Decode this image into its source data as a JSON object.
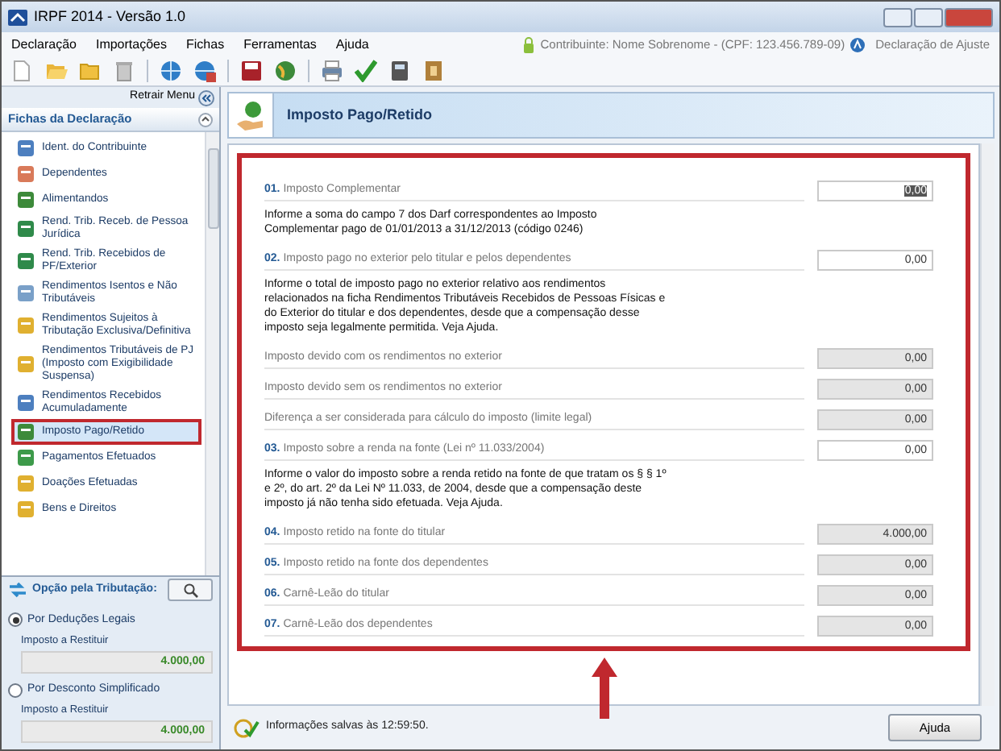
{
  "window": {
    "title": "IRPF 2014 - Versão 1.0"
  },
  "menu": [
    "Declaração",
    "Importações",
    "Fichas",
    "Ferramentas",
    "Ajuda"
  ],
  "header_info": {
    "taxpayer": "Contribuinte: Nome Sobrenome - (CPF: 123.456.789-09)",
    "declaration": "Declaração de Ajuste"
  },
  "sidebar": {
    "collapse_label": "Retrair Menu",
    "section_title": "Fichas da Declaração",
    "items": [
      {
        "label": "Ident. do Contribuinte",
        "selected": false,
        "highlighted": false
      },
      {
        "label": "Dependentes",
        "selected": false,
        "highlighted": false
      },
      {
        "label": "Alimentandos",
        "selected": false,
        "highlighted": false
      },
      {
        "label": "Rend. Trib. Receb. de Pessoa Jurídica",
        "selected": false,
        "highlighted": false
      },
      {
        "label": "Rend. Trib. Recebidos de PF/Exterior",
        "selected": false,
        "highlighted": false
      },
      {
        "label": "Rendimentos Isentos e Não Tributáveis",
        "selected": false,
        "highlighted": false
      },
      {
        "label": "Rendimentos Sujeitos à Tributação Exclusiva/Definitiva",
        "selected": false,
        "highlighted": false
      },
      {
        "label": "Rendimentos Tributáveis de PJ (Imposto com Exigibilidade Suspensa)",
        "selected": false,
        "highlighted": false
      },
      {
        "label": "Rendimentos Recebidos Acumuladamente",
        "selected": false,
        "highlighted": false
      },
      {
        "label": "Imposto Pago/Retido",
        "selected": true,
        "highlighted": true
      },
      {
        "label": "Pagamentos Efetuados",
        "selected": false,
        "highlighted": false
      },
      {
        "label": "Doações Efetuadas",
        "selected": false,
        "highlighted": false
      },
      {
        "label": "Bens e Direitos",
        "selected": false,
        "highlighted": false
      }
    ],
    "taxation": {
      "title": "Opção pela Tributação:",
      "options": [
        {
          "label": "Por Deduções Legais",
          "selected": true,
          "result_label": "Imposto a Restituir",
          "result_value": "4.000,00"
        },
        {
          "label": "Por Desconto Simplificado",
          "selected": false,
          "result_label": "Imposto a Restituir",
          "result_value": "4.000,00"
        }
      ]
    }
  },
  "page": {
    "title": "Imposto Pago/Retido",
    "highlighted": true,
    "annotation_arrow": true,
    "rows": [
      {
        "kind": "input",
        "number": "01.",
        "label": "Imposto Complementar",
        "value": "0,00",
        "text_selected": true
      },
      {
        "kind": "note",
        "text": "Informe a soma do campo 7 dos Darf correspondentes ao Imposto Complementar pago de 01/01/2013 a 31/12/2013 (código 0246)"
      },
      {
        "kind": "input",
        "number": "02.",
        "label": "Imposto pago no exterior pelo titular e pelos dependentes",
        "value": "0,00",
        "text_selected": false
      },
      {
        "kind": "note",
        "text": "Informe o total de imposto pago no exterior relativo aos rendimentos relacionados na ficha Rendimentos Tributáveis Recebidos de Pessoas Físicas e do Exterior do titular e dos dependentes, desde que a compensação desse imposto seja legalmente permitida. Veja Ajuda."
      },
      {
        "kind": "readonly",
        "label": "Imposto devido com os rendimentos no exterior",
        "value": "0,00"
      },
      {
        "kind": "readonly",
        "label": "Imposto devido sem os rendimentos no exterior",
        "value": "0,00"
      },
      {
        "kind": "readonly",
        "label": "Diferença a ser considerada para cálculo do imposto (limite legal)",
        "value": "0,00"
      },
      {
        "kind": "input",
        "number": "03.",
        "label": "Imposto sobre a renda na fonte (Lei nº 11.033/2004)",
        "value": "0,00",
        "text_selected": false
      },
      {
        "kind": "note",
        "text": "Informe o valor do imposto sobre a renda retido na fonte de que tratam os § § 1º e 2º, do art. 2º da Lei Nº 11.033, de 2004, desde que a compensação deste imposto já não tenha sido efetuada. Veja Ajuda."
      },
      {
        "kind": "readonly",
        "number": "04.",
        "label": "Imposto retido na fonte do titular",
        "value": "4.000,00"
      },
      {
        "kind": "readonly",
        "number": "05.",
        "label": "Imposto retido na fonte dos dependentes",
        "value": "0,00"
      },
      {
        "kind": "readonly",
        "number": "06.",
        "label": "Carnê-Leão do titular",
        "value": "0,00"
      },
      {
        "kind": "readonly",
        "number": "07.",
        "label": "Carnê-Leão dos dependentes",
        "value": "0,00"
      }
    ]
  },
  "status_bar": {
    "message": "Informações salvas às 12:59:50.",
    "help_button": "Ajuda"
  }
}
